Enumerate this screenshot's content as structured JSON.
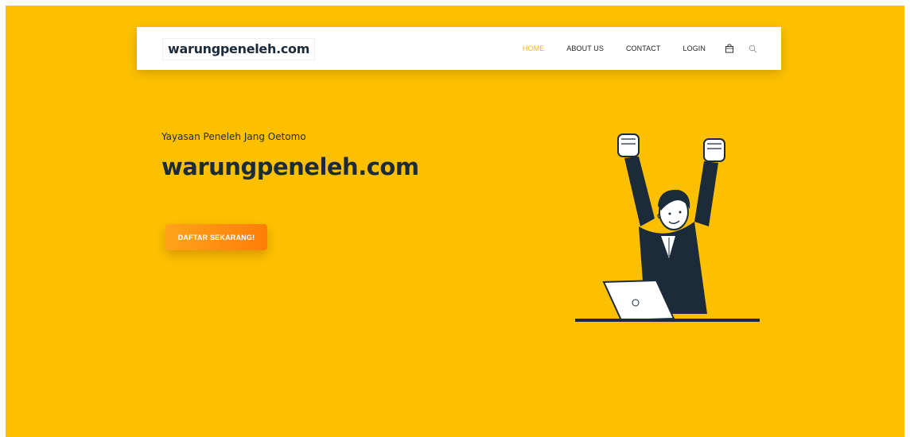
{
  "nav": {
    "logo": "warungpeneleh.com",
    "items": [
      {
        "label": "HOME",
        "active": true
      },
      {
        "label": "ABOUT US",
        "active": false
      },
      {
        "label": "CONTACT",
        "active": false
      },
      {
        "label": "LOGIN",
        "active": false
      }
    ],
    "icons": [
      "shopping-bag-icon",
      "search-icon"
    ]
  },
  "hero": {
    "kicker": "Yayasan Peneleh Jang Oetomo",
    "title": "warungpeneleh.com",
    "cta_label": "DAFTAR SEKARANG!"
  },
  "colors": {
    "background": "#fdc000",
    "accent": "#f7b21f",
    "button_start": "#ffa31a",
    "button_end": "#ff7d09",
    "dark_navy": "#1c2b3a"
  }
}
